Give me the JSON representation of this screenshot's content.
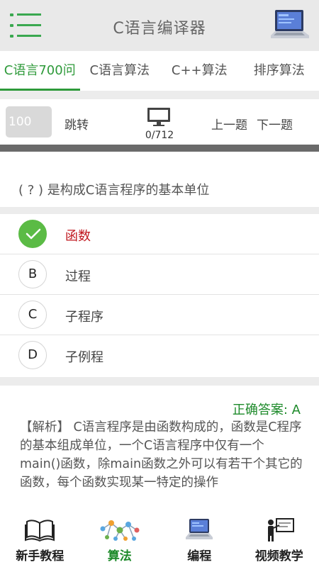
{
  "header": {
    "title": "C语言编译器",
    "menu_icon": "menu-icon",
    "logo_icon": "laptop-icon"
  },
  "tabs": [
    {
      "label": "C语言700问",
      "active": true
    },
    {
      "label": "C语言算法",
      "active": false
    },
    {
      "label": "C++算法",
      "active": false
    },
    {
      "label": "排序算法",
      "active": false
    }
  ],
  "jump": {
    "placeholder": "100",
    "button_label": "跳转",
    "progress": "0/712",
    "prev_label": "上一题",
    "next_label": "下一题",
    "monitor_icon": "monitor-icon"
  },
  "question": {
    "text": "( ? ) 是构成C语言程序的基本单位"
  },
  "options": [
    {
      "letter": "A",
      "text": "函数",
      "correct": true
    },
    {
      "letter": "B",
      "text": "过程",
      "correct": false
    },
    {
      "letter": "C",
      "text": "子程序",
      "correct": false
    },
    {
      "letter": "D",
      "text": "子例程",
      "correct": false
    }
  ],
  "answer": {
    "label": "正确答案: A",
    "analysis": "【解析】 C语言程序是由函数构成的，函数是C程序的基本组成单位，一个C语言程序中仅有一个main()函数，除main函数之外可以有若干个其它的函数，每个函数实现某一特定的操作"
  },
  "bottom_nav": [
    {
      "label": "新手教程",
      "icon": "book-icon",
      "active": false
    },
    {
      "label": "算法",
      "icon": "network-icon",
      "active": true
    },
    {
      "label": "编程",
      "icon": "laptop-icon",
      "active": false
    },
    {
      "label": "视频教学",
      "icon": "teacher-icon",
      "active": false
    }
  ],
  "colors": {
    "accent": "#2e9a3a",
    "correct_red": "#c0171e",
    "correct_badge": "#5bbb45",
    "header_bg": "#e9e9e9"
  }
}
